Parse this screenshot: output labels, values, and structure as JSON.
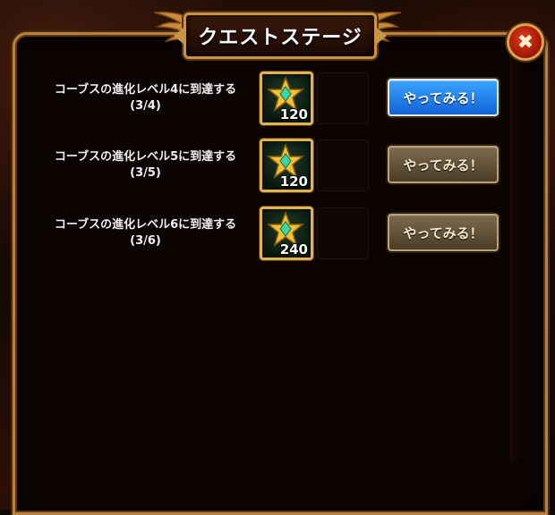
{
  "header": {
    "title": "クエストステージ"
  },
  "close_button": {
    "glyph": "✖",
    "icon": "close-icon"
  },
  "quests": [
    {
      "title": "コーブスの進化レベル4に到達する",
      "progress": "(3/4)",
      "reward_icon": "star-gem-icon",
      "reward_count": "120",
      "button_label": "やってみる！",
      "button_state": "active"
    },
    {
      "title": "コーブスの進化レベル5に到達する",
      "progress": "(3/5)",
      "reward_icon": "star-gem-icon",
      "reward_count": "120",
      "button_label": "やってみる！",
      "button_state": "inactive"
    },
    {
      "title": "コーブスの進化レベル6に到達する",
      "progress": "(3/6)",
      "reward_icon": "star-gem-icon",
      "reward_count": "240",
      "button_label": "やってみる！",
      "button_state": "inactive"
    }
  ],
  "colors": {
    "frame_gold": "#c99446",
    "active_button": "#1e7ff0",
    "inactive_button": "#6a5a40",
    "reward_border": "#e1b24d"
  }
}
